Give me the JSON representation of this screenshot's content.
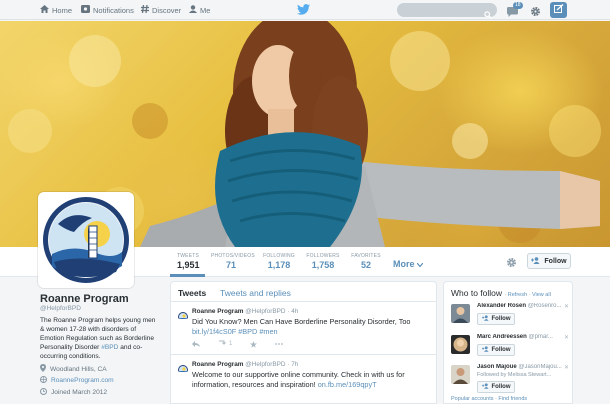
{
  "nav": {
    "home": "Home",
    "notifications": "Notifications",
    "discover": "Discover",
    "me": "Me",
    "search_placeholder": "",
    "dm_badge": "18"
  },
  "profile": {
    "name": "Roanne Program",
    "handle": "@HelpforBPD",
    "bio_text": "The Roanne Program helps young men & women 17-28 with disorders of Emotion Regulation such as Borderline Personality Disorder ",
    "bio_hashtag": "#BPD",
    "bio_end": " and co-occurring conditions.",
    "location": "Woodland Hills, CA",
    "website": "RoanneProgram.com",
    "joined": "Joined March 2012"
  },
  "stats": {
    "tweets": {
      "label": "TWEETS",
      "value": "1,951"
    },
    "photos": {
      "label": "PHOTOS/VIDEOS",
      "value": "71"
    },
    "following": {
      "label": "FOLLOWING",
      "value": "1,178"
    },
    "followers": {
      "label": "FOLLOWERS",
      "value": "1,758"
    },
    "favorites": {
      "label": "FAVORITES",
      "value": "52"
    },
    "more": "More"
  },
  "actions": {
    "follow": "Follow"
  },
  "stream": {
    "tab_tweets": "Tweets",
    "tab_replies": "Tweets and replies",
    "tweets": [
      {
        "name": "Roanne Program",
        "handle": "@HelpforBPD · 4h",
        "text": "Did You Know? Men Can Have Borderline Personality Disorder, Too ",
        "link": "bit.ly/1f4cS0F #BPD #men",
        "retweets": "1"
      },
      {
        "name": "Roanne Program",
        "handle": "@HelpforBPD · 7h",
        "text": "Welcome to our supportive online community. Check in with us for information, resources and inspiration! ",
        "link": "on.fb.me/169qpyT",
        "retweets": ""
      }
    ]
  },
  "who_to_follow": {
    "title": "Who to follow",
    "sep": " · ",
    "refresh": "Refresh",
    "view_all": "View all",
    "suggestions": [
      {
        "name": "Alexander Rosen",
        "handle": "@Rosenro...",
        "sub": "",
        "follow": "Follow"
      },
      {
        "name": "Marc Andreessen",
        "handle": "@pmar...",
        "sub": "",
        "follow": "Follow"
      },
      {
        "name": "Jason Majoue",
        "handle": "@JasonMajou...",
        "sub": "Followed by Melissa Stewart...",
        "follow": "Follow"
      }
    ],
    "footer_popular": "Popular accounts",
    "footer_find": "Find friends"
  },
  "colors": {
    "accent": "#5b8fb9",
    "text": "#292f33",
    "muted": "#8899a6"
  }
}
